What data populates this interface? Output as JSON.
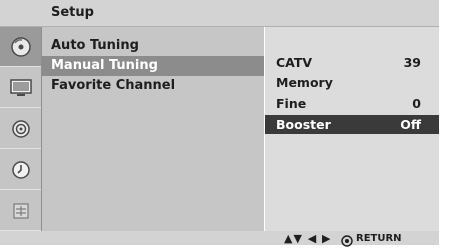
{
  "window": {
    "title": "Setup"
  },
  "sidebar_icons": [
    {
      "name": "station-icon",
      "active": true
    },
    {
      "name": "picture-icon",
      "active": false
    },
    {
      "name": "audio-icon",
      "active": false
    },
    {
      "name": "time-icon",
      "active": false
    },
    {
      "name": "option-icon",
      "active": false
    }
  ],
  "menu": {
    "items": [
      {
        "label": "Auto Tuning",
        "selected": false
      },
      {
        "label": "Manual Tuning",
        "selected": true
      },
      {
        "label": "Favorite Channel",
        "selected": false
      }
    ]
  },
  "submenu": {
    "rows": [
      {
        "label": "CATV",
        "value": "39",
        "selected": false
      },
      {
        "label": "Memory",
        "value": "",
        "selected": false
      },
      {
        "label": "Fine",
        "value": "0",
        "selected": false
      },
      {
        "label": "Booster",
        "value": "Off",
        "selected": true
      }
    ]
  },
  "footer": {
    "navigate_arrows": "▲▼ ◀ ▶",
    "return_label": "RETURN"
  }
}
